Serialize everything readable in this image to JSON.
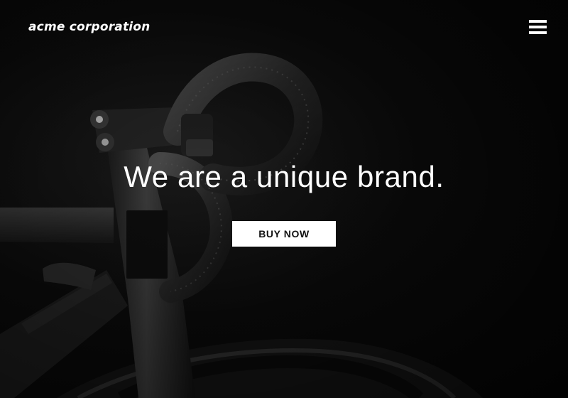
{
  "header": {
    "logo_text": "acme corporation",
    "menu_icon": "hamburger-menu-icon"
  },
  "hero": {
    "headline": "We are a unique brand.",
    "cta_label": "BUY NOW",
    "background_image": "black road bicycle handlebar and front wheel",
    "colors": {
      "background": "#050505",
      "text": "#ffffff",
      "button_bg": "#ffffff",
      "button_text": "#111111"
    }
  }
}
